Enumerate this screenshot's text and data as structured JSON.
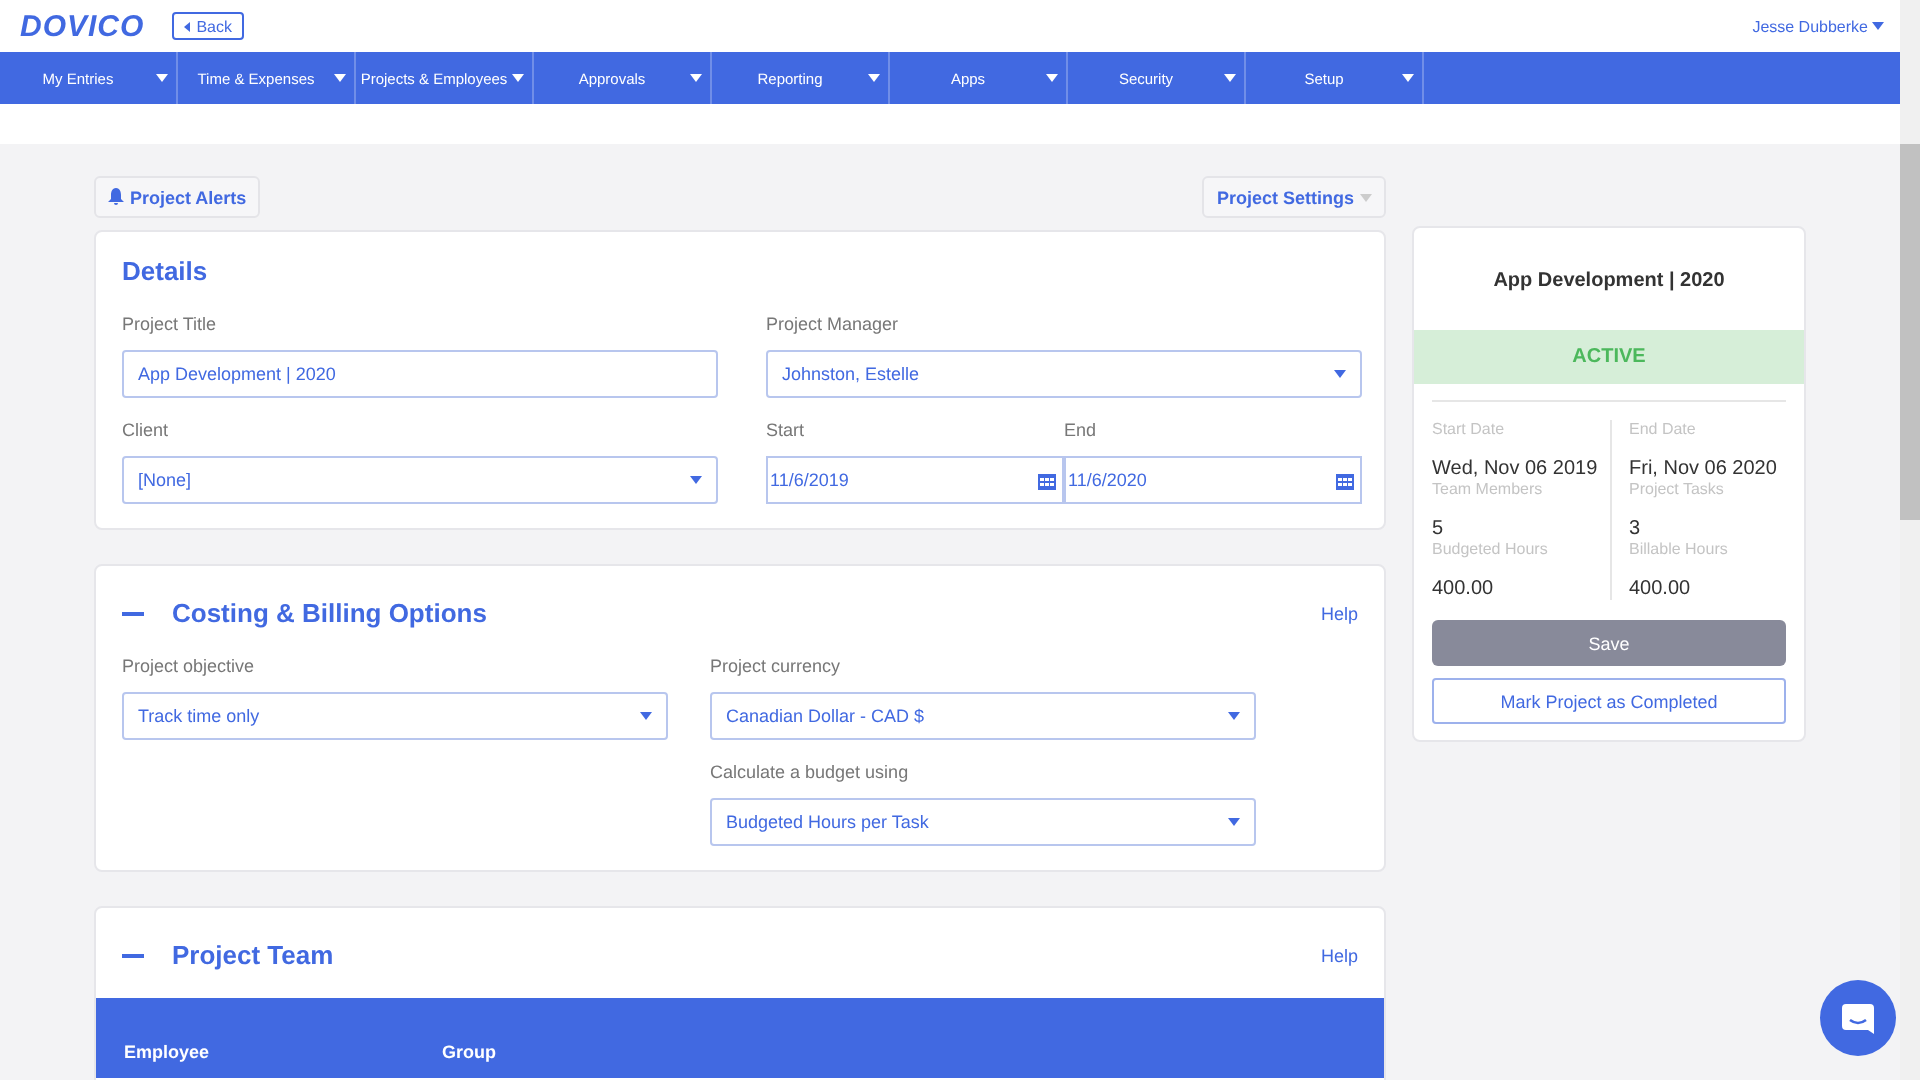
{
  "header": {
    "logo": "DOVICO",
    "back": "Back",
    "user": "Jesse Dubberke"
  },
  "nav": [
    {
      "label": "My Entries"
    },
    {
      "label": "Time & Expenses"
    },
    {
      "label": "Projects & Employees"
    },
    {
      "label": "Approvals"
    },
    {
      "label": "Reporting"
    },
    {
      "label": "Apps"
    },
    {
      "label": "Security"
    },
    {
      "label": "Setup"
    }
  ],
  "toolbar": {
    "alerts": "Project Alerts",
    "settings": "Project Settings"
  },
  "details": {
    "title": "Details",
    "fields": [
      {
        "label": "Project Title",
        "value": "App Development | 2020",
        "kind": "text"
      },
      {
        "label": "Project Manager",
        "value": "Johnston, Estelle",
        "kind": "select"
      },
      {
        "label": "Client",
        "value": "[None]",
        "kind": "select"
      },
      {
        "label": "Start",
        "value": "11/6/2019",
        "kind": "date"
      },
      {
        "label": "End",
        "value": "11/6/2020",
        "kind": "date"
      }
    ]
  },
  "costing": {
    "title": "Costing & Billing Options",
    "help": "Help",
    "expanded": true,
    "fields": [
      {
        "label": "Project objective",
        "value": "Track time only",
        "kind": "select"
      },
      {
        "label": "Project currency",
        "value": "Canadian Dollar - CAD $",
        "kind": "select"
      },
      {
        "label": "Calculate a budget using",
        "value": "Budgeted Hours per Task",
        "kind": "select"
      }
    ]
  },
  "team": {
    "title": "Project Team",
    "help": "Help",
    "expanded": true,
    "columns": [
      "Employee",
      "Group"
    ]
  },
  "summary": {
    "title": "App Development | 2020",
    "status": {
      "label": "ACTIVE",
      "active": true
    },
    "stats": [
      {
        "label": "Start Date",
        "value": "Wed, Nov 06 2019"
      },
      {
        "label": "End Date",
        "value": "Fri, Nov 06 2020"
      },
      {
        "label": "Team Members",
        "value": "5"
      },
      {
        "label": "Project Tasks",
        "value": "3"
      },
      {
        "label": "Budgeted Hours",
        "value": "400.00"
      },
      {
        "label": "Billable Hours",
        "value": "400.00"
      }
    ],
    "save": "Save",
    "complete": "Mark Project as Completed"
  }
}
